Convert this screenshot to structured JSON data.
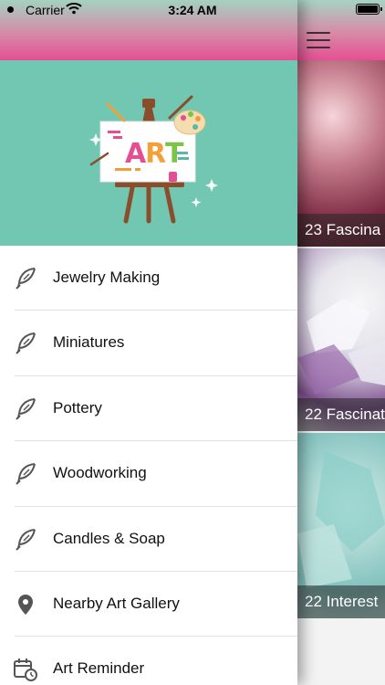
{
  "status_bar": {
    "carrier": "Carrier",
    "time": "3:24 AM"
  },
  "banner": {
    "art_text": "ART",
    "background_color": "#72c7b2"
  },
  "menu": {
    "items": [
      {
        "label": "Jewelry Making",
        "icon": "feather-icon"
      },
      {
        "label": "Miniatures",
        "icon": "feather-icon"
      },
      {
        "label": "Pottery",
        "icon": "feather-icon"
      },
      {
        "label": "Woodworking",
        "icon": "feather-icon"
      },
      {
        "label": "Candles & Soap",
        "icon": "feather-icon"
      },
      {
        "label": "Nearby Art Gallery",
        "icon": "location-pin-icon"
      },
      {
        "label": "Art Reminder",
        "icon": "calendar-clock-icon"
      }
    ]
  },
  "main": {
    "cards": [
      {
        "caption": "23 Fascina"
      },
      {
        "caption": "22 Fascinat"
      },
      {
        "caption": "22 Interest"
      }
    ]
  }
}
